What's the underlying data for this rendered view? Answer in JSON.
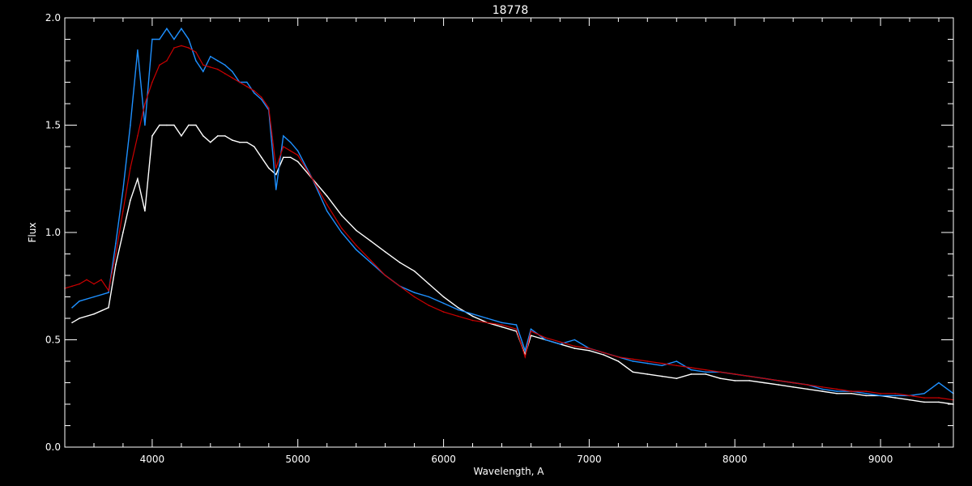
{
  "chart_data": {
    "type": "line",
    "title": "18778",
    "xlabel": "Wavelength, A",
    "ylabel": "Flux",
    "xlim": [
      3400,
      9500
    ],
    "ylim": [
      0.0,
      2.0
    ],
    "x_ticks": [
      4000,
      5000,
      6000,
      7000,
      8000,
      9000
    ],
    "x_tick_labels": [
      "4000",
      "5000",
      "6000",
      "7000",
      "8000",
      "9000"
    ],
    "y_ticks": [
      0.0,
      0.5,
      1.0,
      1.5,
      2.0
    ],
    "y_tick_labels": [
      "0.0",
      "0.5",
      "1.0",
      "1.5",
      "2.0"
    ],
    "grid": false,
    "legend": "none",
    "colors": {
      "background": "#000000",
      "axes": "#ffffff"
    },
    "series": [
      {
        "color": "#ffffff",
        "x": [
          3450,
          3500,
          3600,
          3700,
          3750,
          3800,
          3850,
          3900,
          3950,
          4000,
          4050,
          4100,
          4150,
          4200,
          4250,
          4300,
          4350,
          4400,
          4450,
          4500,
          4550,
          4600,
          4650,
          4700,
          4750,
          4800,
          4850,
          4900,
          4950,
          5000,
          5100,
          5200,
          5300,
          5400,
          5500,
          5600,
          5700,
          5800,
          5900,
          6000,
          6100,
          6200,
          6300,
          6400,
          6500,
          6560,
          6600,
          6700,
          6800,
          6900,
          7000,
          7100,
          7200,
          7300,
          7400,
          7500,
          7600,
          7700,
          7800,
          7900,
          8000,
          8100,
          8200,
          8300,
          8400,
          8500,
          8600,
          8700,
          8800,
          8900,
          9000,
          9100,
          9200,
          9300,
          9400,
          9500
        ],
        "values": [
          0.58,
          0.6,
          0.62,
          0.65,
          0.85,
          1.0,
          1.15,
          1.25,
          1.1,
          1.45,
          1.5,
          1.5,
          1.5,
          1.45,
          1.5,
          1.5,
          1.45,
          1.42,
          1.45,
          1.45,
          1.43,
          1.42,
          1.42,
          1.4,
          1.35,
          1.3,
          1.27,
          1.35,
          1.35,
          1.33,
          1.25,
          1.17,
          1.08,
          1.01,
          0.96,
          0.91,
          0.86,
          0.82,
          0.76,
          0.7,
          0.65,
          0.61,
          0.58,
          0.56,
          0.54,
          0.43,
          0.52,
          0.5,
          0.48,
          0.46,
          0.45,
          0.43,
          0.4,
          0.35,
          0.34,
          0.33,
          0.32,
          0.34,
          0.34,
          0.32,
          0.31,
          0.31,
          0.3,
          0.29,
          0.28,
          0.27,
          0.26,
          0.25,
          0.25,
          0.24,
          0.24,
          0.23,
          0.22,
          0.21,
          0.21,
          0.2
        ]
      },
      {
        "color": "#1e90ff",
        "x": [
          3450,
          3500,
          3600,
          3700,
          3750,
          3800,
          3850,
          3900,
          3950,
          4000,
          4050,
          4100,
          4150,
          4200,
          4250,
          4300,
          4350,
          4400,
          4450,
          4500,
          4550,
          4600,
          4650,
          4700,
          4750,
          4800,
          4850,
          4900,
          4950,
          5000,
          5100,
          5200,
          5300,
          5400,
          5500,
          5600,
          5700,
          5800,
          5900,
          6000,
          6100,
          6200,
          6300,
          6400,
          6500,
          6560,
          6600,
          6700,
          6800,
          6900,
          7000,
          7100,
          7200,
          7300,
          7400,
          7500,
          7600,
          7700,
          7800,
          7900,
          8000,
          8100,
          8200,
          8300,
          8400,
          8500,
          8600,
          8700,
          8800,
          8900,
          9000,
          9100,
          9200,
          9300,
          9400,
          9500
        ],
        "values": [
          0.65,
          0.68,
          0.7,
          0.72,
          0.95,
          1.2,
          1.5,
          1.85,
          1.5,
          1.9,
          1.9,
          1.95,
          1.9,
          1.95,
          1.9,
          1.8,
          1.75,
          1.82,
          1.8,
          1.78,
          1.75,
          1.7,
          1.7,
          1.65,
          1.62,
          1.57,
          1.2,
          1.45,
          1.42,
          1.38,
          1.25,
          1.1,
          1.0,
          0.92,
          0.86,
          0.8,
          0.75,
          0.72,
          0.7,
          0.67,
          0.64,
          0.62,
          0.6,
          0.58,
          0.57,
          0.45,
          0.55,
          0.5,
          0.48,
          0.5,
          0.46,
          0.44,
          0.42,
          0.4,
          0.39,
          0.38,
          0.4,
          0.36,
          0.35,
          0.35,
          0.34,
          0.33,
          0.32,
          0.31,
          0.3,
          0.29,
          0.27,
          0.26,
          0.26,
          0.25,
          0.24,
          0.24,
          0.24,
          0.25,
          0.3,
          0.25
        ]
      },
      {
        "color": "#cc0000",
        "x": [
          3400,
          3450,
          3500,
          3550,
          3600,
          3650,
          3700,
          3750,
          3800,
          3850,
          3900,
          3950,
          4000,
          4050,
          4100,
          4150,
          4200,
          4250,
          4300,
          4350,
          4400,
          4450,
          4500,
          4550,
          4600,
          4650,
          4700,
          4750,
          4800,
          4850,
          4900,
          4950,
          5000,
          5100,
          5200,
          5300,
          5400,
          5500,
          5600,
          5700,
          5800,
          5900,
          6000,
          6100,
          6200,
          6300,
          6400,
          6500,
          6560,
          6600,
          6700,
          6800,
          6900,
          7000,
          7100,
          7200,
          7300,
          7400,
          7500,
          7600,
          7700,
          7800,
          7900,
          8000,
          8100,
          8200,
          8300,
          8400,
          8500,
          8600,
          8700,
          8800,
          8900,
          9000,
          9100,
          9200,
          9300,
          9400,
          9500
        ],
        "values": [
          0.74,
          0.75,
          0.76,
          0.78,
          0.76,
          0.78,
          0.73,
          0.9,
          1.1,
          1.3,
          1.45,
          1.6,
          1.7,
          1.78,
          1.8,
          1.86,
          1.87,
          1.86,
          1.84,
          1.78,
          1.77,
          1.76,
          1.74,
          1.72,
          1.7,
          1.68,
          1.66,
          1.63,
          1.58,
          1.3,
          1.4,
          1.38,
          1.36,
          1.25,
          1.13,
          1.02,
          0.94,
          0.87,
          0.8,
          0.75,
          0.7,
          0.66,
          0.63,
          0.61,
          0.59,
          0.58,
          0.57,
          0.55,
          0.42,
          0.54,
          0.51,
          0.49,
          0.47,
          0.46,
          0.44,
          0.42,
          0.41,
          0.4,
          0.39,
          0.38,
          0.37,
          0.36,
          0.35,
          0.34,
          0.33,
          0.32,
          0.31,
          0.3,
          0.29,
          0.28,
          0.27,
          0.26,
          0.26,
          0.25,
          0.25,
          0.24,
          0.23,
          0.23,
          0.22
        ]
      }
    ]
  }
}
